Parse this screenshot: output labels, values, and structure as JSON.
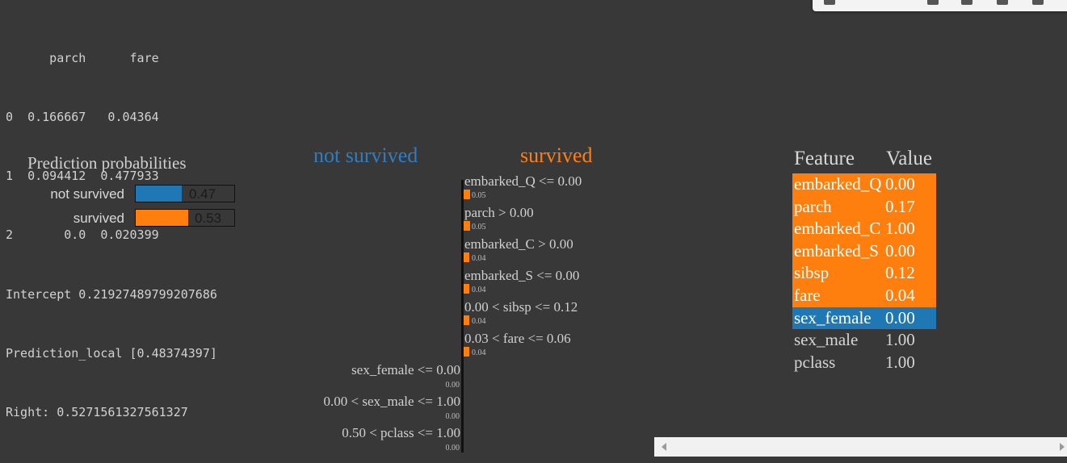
{
  "output_text": {
    "lines": [
      "      parch      fare",
      "0  0.166667   0.04364",
      "1  0.094412  0.477933",
      "2       0.0  0.020399",
      "Intercept 0.21927489799207686",
      "Prediction_local [0.48374397]",
      "Right: 0.5271561327561327"
    ]
  },
  "prediction_probabilities": {
    "title": "Prediction probabilities",
    "items": [
      {
        "label": "not survived",
        "value_text": "0.47",
        "value": 0.47,
        "color": "#1f77b4"
      },
      {
        "label": "survived",
        "value_text": "0.53",
        "value": 0.53,
        "color": "#ff7f0e"
      }
    ]
  },
  "explanation_chart": {
    "neg_label": "not survived",
    "pos_label": "survived",
    "neg_color": "#1f77b4",
    "pos_color": "#ff7f0e",
    "features": [
      {
        "condition": "embarked_Q <= 0.00",
        "weight_text": "0.05",
        "side": "pos"
      },
      {
        "condition": "parch > 0.00",
        "weight_text": "0.05",
        "side": "pos"
      },
      {
        "condition": "embarked_C > 0.00",
        "weight_text": "0.04",
        "side": "pos"
      },
      {
        "condition": "embarked_S <= 0.00",
        "weight_text": "0.04",
        "side": "pos"
      },
      {
        "condition": "0.00 < sibsp <= 0.12",
        "weight_text": "0.04",
        "side": "pos"
      },
      {
        "condition": "0.03 < fare <= 0.06",
        "weight_text": "0.04",
        "side": "pos"
      },
      {
        "condition": "sex_female <= 0.00",
        "weight_text": "0.00",
        "side": "neg"
      },
      {
        "condition": "0.00 < sex_male <= 1.00",
        "weight_text": "0.00",
        "side": "neg"
      },
      {
        "condition": "0.50 < pclass <= 1.00",
        "weight_text": "0.00",
        "side": "neg"
      }
    ]
  },
  "feature_table": {
    "headers": [
      "Feature",
      "Value"
    ],
    "rows": [
      {
        "feature": "embarked_Q",
        "value": "0.00",
        "highlight": "orange"
      },
      {
        "feature": "parch",
        "value": "0.17",
        "highlight": "orange"
      },
      {
        "feature": "embarked_C",
        "value": "1.00",
        "highlight": "orange"
      },
      {
        "feature": "embarked_S",
        "value": "0.00",
        "highlight": "orange"
      },
      {
        "feature": "sibsp",
        "value": "0.12",
        "highlight": "orange"
      },
      {
        "feature": "fare",
        "value": "0.04",
        "highlight": "orange"
      },
      {
        "feature": "sex_female",
        "value": "0.00",
        "highlight": "blue"
      },
      {
        "feature": "sex_male",
        "value": "1.00",
        "highlight": "none"
      },
      {
        "feature": "pclass",
        "value": "1.00",
        "highlight": "none"
      }
    ]
  },
  "colors": {
    "background": "#383838",
    "orange": "#ff7f0e",
    "blue": "#1f77b4"
  }
}
